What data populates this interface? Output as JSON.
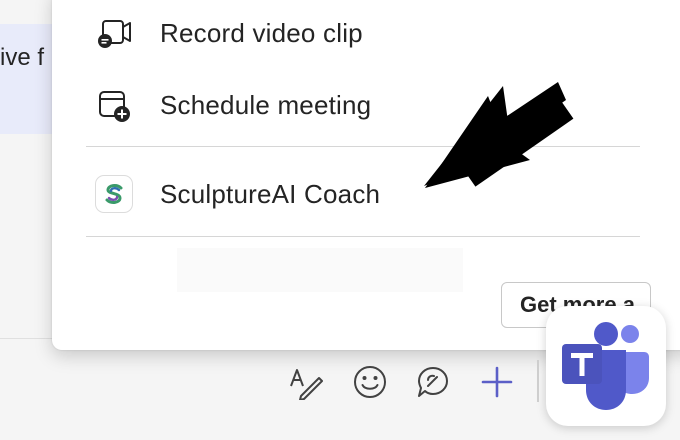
{
  "background": {
    "chat_snippet": "ive f"
  },
  "menu": {
    "items": [
      {
        "label": "Record video clip",
        "icon": "record-video-icon"
      },
      {
        "label": "Schedule meeting",
        "icon": "calendar-add-icon"
      },
      {
        "label": "SculptureAI Coach",
        "icon": "sculpture-ai-app-icon"
      }
    ],
    "get_more_label": "Get more a"
  },
  "toolbar": {
    "icons": [
      "format-icon",
      "emoji-icon",
      "loop-icon",
      "plus-icon"
    ]
  },
  "colors": {
    "accent": "#5b5fc7",
    "teams_purple": "#4b53bc",
    "bubble": "#e8ebfa"
  }
}
